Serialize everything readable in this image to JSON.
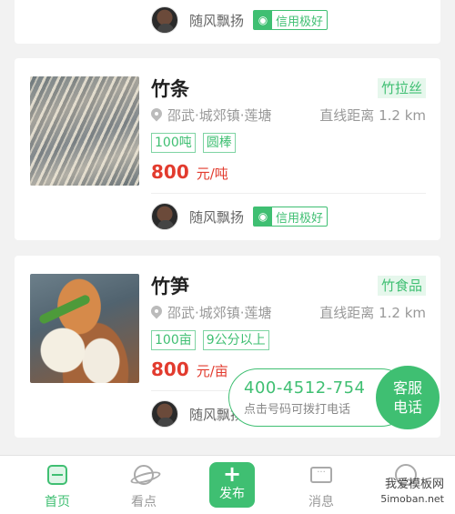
{
  "top_card": {
    "user": "随风飘扬",
    "credit": "信用极好"
  },
  "listings": [
    {
      "title": "竹条",
      "category": "竹拉丝",
      "location": "邵武·城郊镇·莲塘",
      "distance": "直线距离 1.2 km",
      "specs": [
        "100吨",
        "圆棒"
      ],
      "price": "800",
      "unit": "元/吨",
      "user": "随风飘扬",
      "credit": "信用极好"
    },
    {
      "title": "竹笋",
      "category": "竹食品",
      "location": "邵武·城郊镇·莲塘",
      "distance": "直线距离 1.2 km",
      "specs": [
        "100亩",
        "9公分以上"
      ],
      "price": "800",
      "unit": "元/亩",
      "user": "随风飘扬",
      "credit": "信用极好"
    }
  ],
  "service": {
    "phone": "400-4512-754",
    "hint": "点击号码可拨打电话",
    "button_line1": "客服",
    "button_line2": "电话"
  },
  "tabbar": {
    "home": "首页",
    "discover": "看点",
    "publish": "发布",
    "messages": "消息",
    "mine": ""
  },
  "watermark": {
    "line1": "我爱模板网",
    "line2": "5imoban.net"
  },
  "colors": {
    "accent": "#3fbf72",
    "price": "#e23b2e"
  }
}
